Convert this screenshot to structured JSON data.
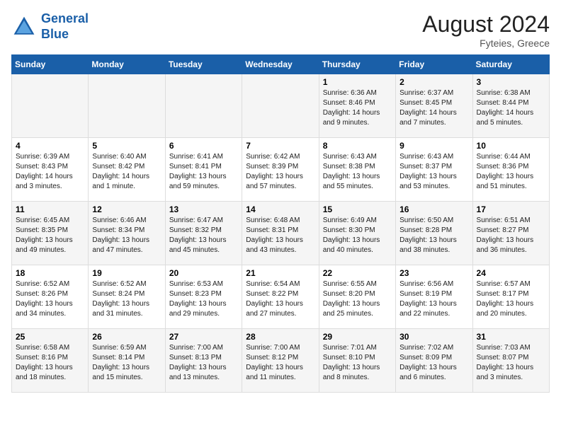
{
  "logo": {
    "line1": "General",
    "line2": "Blue"
  },
  "title": {
    "month_year": "August 2024",
    "location": "Fyteies, Greece"
  },
  "days_of_week": [
    "Sunday",
    "Monday",
    "Tuesday",
    "Wednesday",
    "Thursday",
    "Friday",
    "Saturday"
  ],
  "weeks": [
    [
      {
        "day": "",
        "info": ""
      },
      {
        "day": "",
        "info": ""
      },
      {
        "day": "",
        "info": ""
      },
      {
        "day": "",
        "info": ""
      },
      {
        "day": "1",
        "info": "Sunrise: 6:36 AM\nSunset: 8:46 PM\nDaylight: 14 hours\nand 9 minutes."
      },
      {
        "day": "2",
        "info": "Sunrise: 6:37 AM\nSunset: 8:45 PM\nDaylight: 14 hours\nand 7 minutes."
      },
      {
        "day": "3",
        "info": "Sunrise: 6:38 AM\nSunset: 8:44 PM\nDaylight: 14 hours\nand 5 minutes."
      }
    ],
    [
      {
        "day": "4",
        "info": "Sunrise: 6:39 AM\nSunset: 8:43 PM\nDaylight: 14 hours\nand 3 minutes."
      },
      {
        "day": "5",
        "info": "Sunrise: 6:40 AM\nSunset: 8:42 PM\nDaylight: 14 hours\nand 1 minute."
      },
      {
        "day": "6",
        "info": "Sunrise: 6:41 AM\nSunset: 8:41 PM\nDaylight: 13 hours\nand 59 minutes."
      },
      {
        "day": "7",
        "info": "Sunrise: 6:42 AM\nSunset: 8:39 PM\nDaylight: 13 hours\nand 57 minutes."
      },
      {
        "day": "8",
        "info": "Sunrise: 6:43 AM\nSunset: 8:38 PM\nDaylight: 13 hours\nand 55 minutes."
      },
      {
        "day": "9",
        "info": "Sunrise: 6:43 AM\nSunset: 8:37 PM\nDaylight: 13 hours\nand 53 minutes."
      },
      {
        "day": "10",
        "info": "Sunrise: 6:44 AM\nSunset: 8:36 PM\nDaylight: 13 hours\nand 51 minutes."
      }
    ],
    [
      {
        "day": "11",
        "info": "Sunrise: 6:45 AM\nSunset: 8:35 PM\nDaylight: 13 hours\nand 49 minutes."
      },
      {
        "day": "12",
        "info": "Sunrise: 6:46 AM\nSunset: 8:34 PM\nDaylight: 13 hours\nand 47 minutes."
      },
      {
        "day": "13",
        "info": "Sunrise: 6:47 AM\nSunset: 8:32 PM\nDaylight: 13 hours\nand 45 minutes."
      },
      {
        "day": "14",
        "info": "Sunrise: 6:48 AM\nSunset: 8:31 PM\nDaylight: 13 hours\nand 43 minutes."
      },
      {
        "day": "15",
        "info": "Sunrise: 6:49 AM\nSunset: 8:30 PM\nDaylight: 13 hours\nand 40 minutes."
      },
      {
        "day": "16",
        "info": "Sunrise: 6:50 AM\nSunset: 8:28 PM\nDaylight: 13 hours\nand 38 minutes."
      },
      {
        "day": "17",
        "info": "Sunrise: 6:51 AM\nSunset: 8:27 PM\nDaylight: 13 hours\nand 36 minutes."
      }
    ],
    [
      {
        "day": "18",
        "info": "Sunrise: 6:52 AM\nSunset: 8:26 PM\nDaylight: 13 hours\nand 34 minutes."
      },
      {
        "day": "19",
        "info": "Sunrise: 6:52 AM\nSunset: 8:24 PM\nDaylight: 13 hours\nand 31 minutes."
      },
      {
        "day": "20",
        "info": "Sunrise: 6:53 AM\nSunset: 8:23 PM\nDaylight: 13 hours\nand 29 minutes."
      },
      {
        "day": "21",
        "info": "Sunrise: 6:54 AM\nSunset: 8:22 PM\nDaylight: 13 hours\nand 27 minutes."
      },
      {
        "day": "22",
        "info": "Sunrise: 6:55 AM\nSunset: 8:20 PM\nDaylight: 13 hours\nand 25 minutes."
      },
      {
        "day": "23",
        "info": "Sunrise: 6:56 AM\nSunset: 8:19 PM\nDaylight: 13 hours\nand 22 minutes."
      },
      {
        "day": "24",
        "info": "Sunrise: 6:57 AM\nSunset: 8:17 PM\nDaylight: 13 hours\nand 20 minutes."
      }
    ],
    [
      {
        "day": "25",
        "info": "Sunrise: 6:58 AM\nSunset: 8:16 PM\nDaylight: 13 hours\nand 18 minutes."
      },
      {
        "day": "26",
        "info": "Sunrise: 6:59 AM\nSunset: 8:14 PM\nDaylight: 13 hours\nand 15 minutes."
      },
      {
        "day": "27",
        "info": "Sunrise: 7:00 AM\nSunset: 8:13 PM\nDaylight: 13 hours\nand 13 minutes."
      },
      {
        "day": "28",
        "info": "Sunrise: 7:00 AM\nSunset: 8:12 PM\nDaylight: 13 hours\nand 11 minutes."
      },
      {
        "day": "29",
        "info": "Sunrise: 7:01 AM\nSunset: 8:10 PM\nDaylight: 13 hours\nand 8 minutes."
      },
      {
        "day": "30",
        "info": "Sunrise: 7:02 AM\nSunset: 8:09 PM\nDaylight: 13 hours\nand 6 minutes."
      },
      {
        "day": "31",
        "info": "Sunrise: 7:03 AM\nSunset: 8:07 PM\nDaylight: 13 hours\nand 3 minutes."
      }
    ]
  ],
  "colors": {
    "header_bg": "#1a5fa8",
    "header_text": "#ffffff",
    "odd_row": "#f5f5f5",
    "even_row": "#ffffff",
    "border": "#dddddd"
  }
}
